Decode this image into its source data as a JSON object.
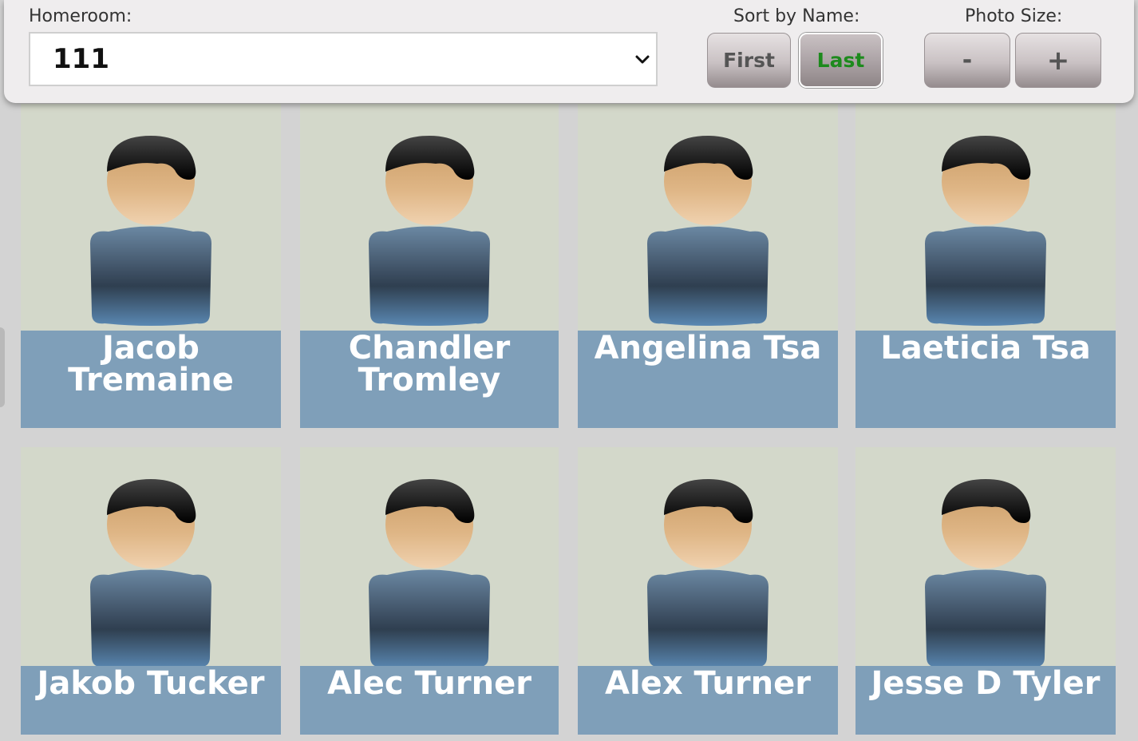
{
  "toolbar": {
    "homeroom_label": "Homeroom:",
    "homeroom_value": "111",
    "sort_label": "Sort by Name:",
    "sort_first": "First",
    "sort_last": "Last",
    "sort_selected": "Last",
    "photo_size_label": "Photo Size:",
    "size_minus": "-",
    "size_plus": "+"
  },
  "colors": {
    "card_bg": "#d3d8ca",
    "name_bar": "#7f9fb9",
    "active_sort_text": "#1d8a1d"
  },
  "students": [
    {
      "name": "Jacob Tremaine",
      "icon": "person-placeholder-icon"
    },
    {
      "name": "Chandler Tromley",
      "icon": "person-placeholder-icon"
    },
    {
      "name": "Angelina Tsa",
      "icon": "person-placeholder-icon"
    },
    {
      "name": "Laeticia Tsa",
      "icon": "person-placeholder-icon"
    },
    {
      "name": "Jakob Tucker",
      "icon": "person-placeholder-icon"
    },
    {
      "name": "Alec Turner",
      "icon": "person-placeholder-icon"
    },
    {
      "name": "Alex Turner",
      "icon": "person-placeholder-icon"
    },
    {
      "name": "Jesse D Tyler",
      "icon": "person-placeholder-icon"
    }
  ]
}
